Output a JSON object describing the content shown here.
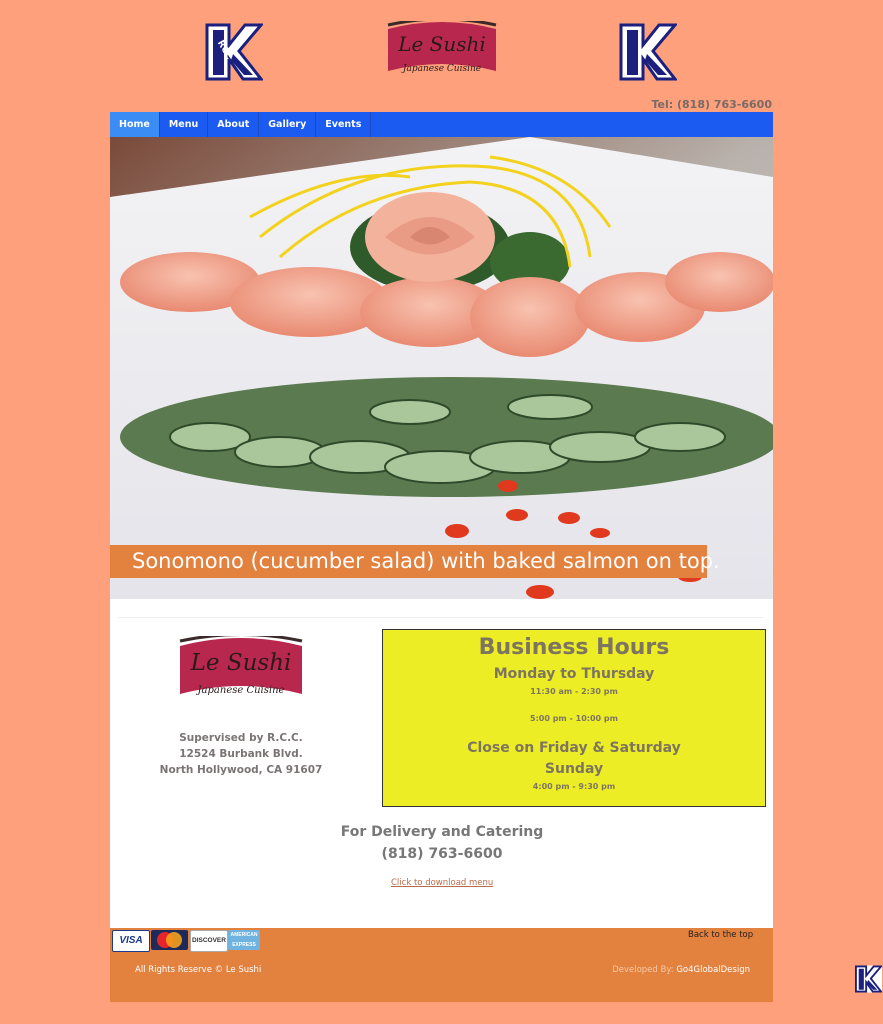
{
  "header": {
    "rcc_logo_text": "RCC",
    "brand_name": "Le Sushi",
    "brand_tagline": "Japanese Cuisine",
    "tel": "Tel: (818) 763-6600"
  },
  "nav": {
    "items": [
      {
        "label": "Home"
      },
      {
        "label": "Menu"
      },
      {
        "label": "About"
      },
      {
        "label": "Gallery"
      },
      {
        "label": "Events"
      }
    ],
    "active": "Home",
    "color": "#1c5bf2"
  },
  "hero": {
    "caption": "Sonomono (cucumber salad) with baked salmon on top."
  },
  "info": {
    "supervised": "Supervised by R.C.C.",
    "address1": "12524 Burbank Blvd.",
    "address2": "North Hollywood, CA 91607"
  },
  "hours": {
    "title": "Business Hours",
    "weekday_title": "Monday to Thursday",
    "weekday_lunch": "11:30 am - 2:30 pm",
    "weekday_dinner": "5:00 pm - 10:00 pm",
    "weekend_title_1": "Close on Friday & Saturday",
    "weekend_title_2": "Sunday",
    "weekend_hours": "4:00 pm - 9:30 pm"
  },
  "delivery": {
    "title": "For Delivery and Catering",
    "phone": "(818) 763-6600",
    "menu_link": "Click to download menu"
  },
  "footer": {
    "cards": [
      "VISA",
      "MasterCard",
      "DISCOVER",
      "AMERICAN EXPRESS"
    ],
    "back_to_top": "Back to the top",
    "rights": "All Rights Reserve © Le Sushi",
    "developed_by_label": "Developed By:",
    "developer": "Go4GlobalDesign"
  },
  "colors": {
    "background": "#fea07b",
    "accent": "#e3813f",
    "hours_panel": "#eded25"
  }
}
